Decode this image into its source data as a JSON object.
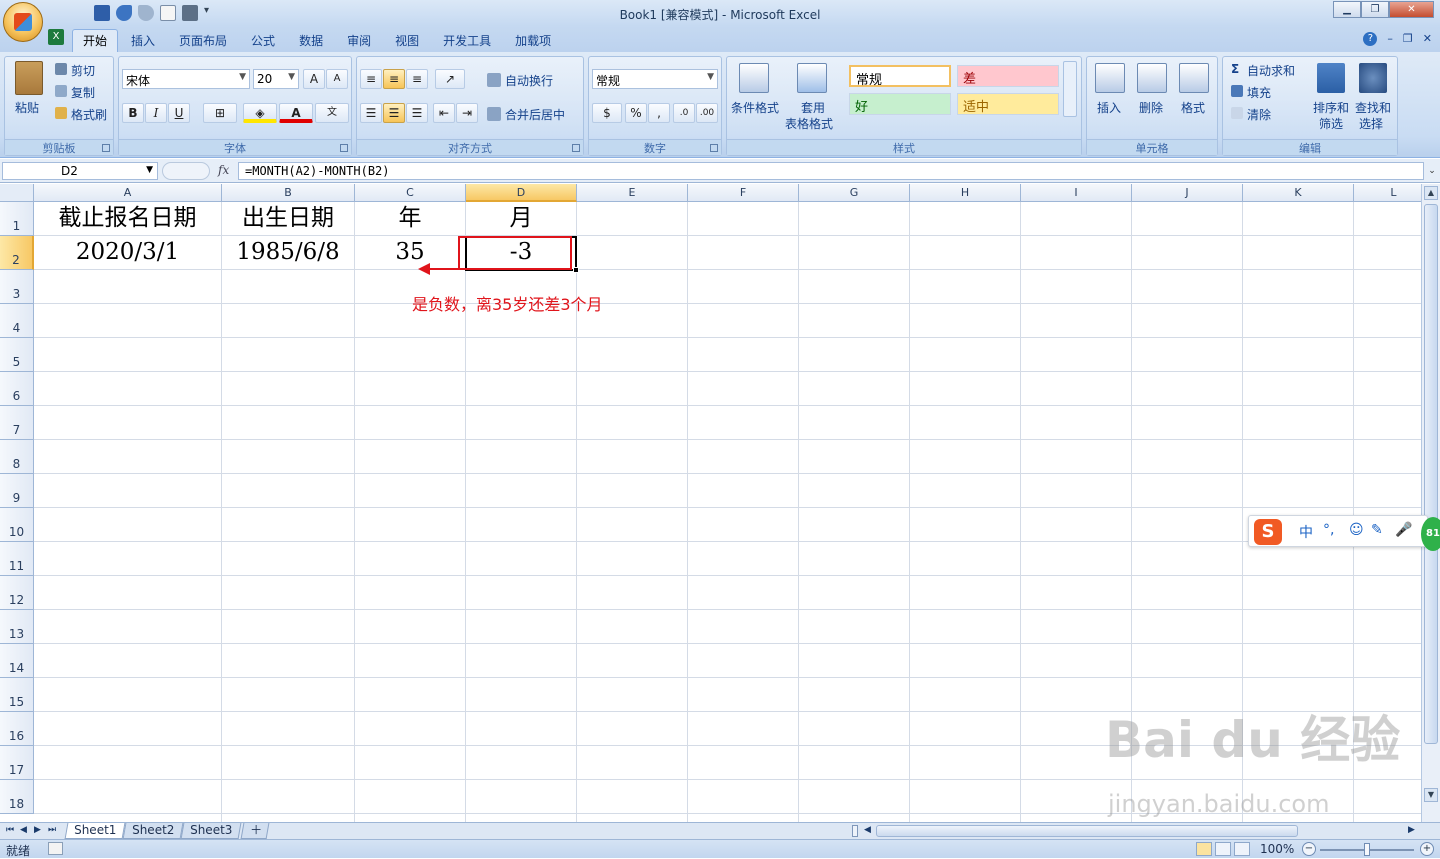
{
  "window": {
    "title": "Book1  [兼容模式] - Microsoft Excel"
  },
  "tabs": [
    {
      "label": "开始"
    },
    {
      "label": "插入"
    },
    {
      "label": "页面布局"
    },
    {
      "label": "公式"
    },
    {
      "label": "数据"
    },
    {
      "label": "审阅"
    },
    {
      "label": "视图"
    },
    {
      "label": "开发工具"
    },
    {
      "label": "加载项"
    }
  ],
  "ribbon": {
    "clipboard": {
      "paste": "粘贴",
      "cut": "剪切",
      "copy": "复制",
      "format_painter": "格式刷",
      "label": "剪贴板"
    },
    "font": {
      "name": "宋体",
      "size": "20",
      "bold": "B",
      "italic": "I",
      "underline": "U",
      "label": "字体"
    },
    "alignment": {
      "wrap": "自动换行",
      "merge": "合并后居中",
      "label": "对齐方式"
    },
    "number": {
      "format": "常规",
      "percent": "%",
      "comma": ",",
      "label": "数字"
    },
    "styles": {
      "conditional": "条件格式",
      "table_a": "套用",
      "table_b": "表格格式",
      "normal": "常规",
      "bad": "差",
      "good": "好",
      "neutral": "适中",
      "label": "样式"
    },
    "cells": {
      "insert": "插入",
      "delete": "删除",
      "format": "格式",
      "label": "单元格"
    },
    "editing": {
      "autosum": "自动求和",
      "fill": "填充",
      "clear": "清除",
      "sort_a": "排序和",
      "sort_b": "筛选",
      "find_a": "查找和",
      "find_b": "选择",
      "label": "编辑"
    }
  },
  "formula_bar": {
    "name_box": "D2",
    "fx": "fx",
    "formula": "=MONTH(A2)-MONTH(B2)"
  },
  "columns": [
    "A",
    "B",
    "C",
    "D",
    "E",
    "F",
    "G",
    "H",
    "I",
    "J",
    "K",
    "L"
  ],
  "rows": [
    "1",
    "2",
    "3",
    "4",
    "5",
    "6",
    "7",
    "8",
    "9",
    "10",
    "11",
    "12",
    "13",
    "14",
    "15",
    "16",
    "17",
    "18"
  ],
  "cells": {
    "A1": "截止报名日期",
    "B1": "出生日期",
    "C1": "年",
    "D1": "月",
    "A2": "2020/3/1",
    "B2": "1985/6/8",
    "C2": "35",
    "D2": "-3"
  },
  "annotation": "是负数，离35岁还差3个月",
  "sheet_tabs": [
    "Sheet1",
    "Sheet2",
    "Sheet3"
  ],
  "status": {
    "ready": "就绪",
    "zoom": "100%"
  },
  "ime": {
    "lang": "中",
    "punct": "°,"
  },
  "watermark": {
    "brand": "Bai du 经验",
    "url": "jingyan.baidu.com"
  },
  "colors": {
    "accent_red": "#e0141b",
    "selection": "#f7c865",
    "bad_fill": "#ffc7ce",
    "good_fill": "#c6efce",
    "neutral_fill": "#ffeb9c"
  }
}
